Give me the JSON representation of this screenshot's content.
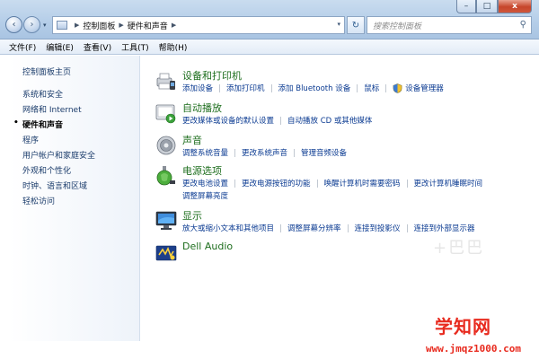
{
  "address": {
    "crumbs": [
      "控制面板",
      "硬件和声音"
    ],
    "search_placeholder": "搜索控制面板"
  },
  "window": {
    "min_glyph": "–",
    "max_glyph": "□",
    "close_glyph": "x"
  },
  "nav": {
    "back_glyph": "‹",
    "forward_glyph": "›",
    "dropdown_glyph": "▾",
    "refresh_glyph": "↻",
    "search_glyph": "⚲"
  },
  "menu": [
    "文件(F)",
    "编辑(E)",
    "查看(V)",
    "工具(T)",
    "帮助(H)"
  ],
  "sidebar": {
    "items": [
      {
        "label": "控制面板主页"
      },
      {
        "label": "系统和安全"
      },
      {
        "label": "网络和 Internet"
      },
      {
        "label": "硬件和声音",
        "active": true
      },
      {
        "label": "程序"
      },
      {
        "label": "用户帐户和家庭安全"
      },
      {
        "label": "外观和个性化"
      },
      {
        "label": "时钟、语言和区域"
      },
      {
        "label": "轻松访问"
      }
    ]
  },
  "categories": [
    {
      "title": "设备和打印机",
      "icon": "printer-icon",
      "link_rows": [
        [
          "添加设备",
          "添加打印机",
          "添加 Bluetooth 设备",
          "鼠标",
          "设备管理器"
        ]
      ]
    },
    {
      "title": "自动播放",
      "icon": "autoplay-icon",
      "link_rows": [
        [
          "更改媒体或设备的默认设置",
          "自动播放 CD 或其他媒体"
        ]
      ]
    },
    {
      "title": "声音",
      "icon": "speaker-icon",
      "link_rows": [
        [
          "调整系统音量",
          "更改系统声音",
          "管理音频设备"
        ]
      ]
    },
    {
      "title": "电源选项",
      "icon": "power-icon",
      "link_rows": [
        [
          "更改电池设置",
          "更改电源按钮的功能",
          "唤醒计算机时需要密码",
          "更改计算机睡眠时间"
        ],
        [
          "调整屏幕亮度"
        ]
      ]
    },
    {
      "title": "显示",
      "icon": "display-icon",
      "link_rows": [
        [
          "放大或缩小文本和其他项目",
          "调整屏幕分辨率",
          "连接到投影仪",
          "连接到外部显示器"
        ]
      ]
    },
    {
      "title": "Dell Audio",
      "icon": "dell-audio-icon",
      "link_rows": []
    }
  ],
  "watermark": {
    "faint": "+巴巴",
    "site_name": "学知网",
    "site_url": "www.jmqz1000.com"
  },
  "colors": {
    "link": "#0a3a91",
    "category_title": "#1e6e1e",
    "sidebar_link": "#1b3c6b",
    "watermark": "#e82a1e"
  }
}
